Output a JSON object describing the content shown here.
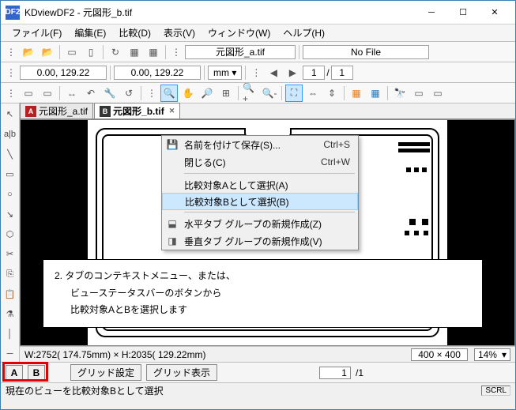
{
  "window": {
    "app_icon": "DF2",
    "title": "KDviewDF2 - 元図形_b.tif"
  },
  "menu": {
    "file": "ファイル(F)",
    "edit": "編集(E)",
    "compare": "比較(D)",
    "view": "表示(V)",
    "window": "ウィンドウ(W)",
    "help": "ヘルプ(H)"
  },
  "address": {
    "file_a": "元図形_a.tif",
    "file_b": "No File"
  },
  "coords": {
    "a": "0.00, 129.22",
    "b": "0.00, 129.22",
    "unit": "mm",
    "page_cur": "1",
    "page_tot": "1"
  },
  "tabs": {
    "a": "元図形_a.tif",
    "b": "元図形_b.tif"
  },
  "context_menu": {
    "save_as": "名前を付けて保存(S)...",
    "save_as_sc": "Ctrl+S",
    "close": "閉じる(C)",
    "close_sc": "Ctrl+W",
    "sel_a": "比較対象Aとして選択(A)",
    "sel_b": "比較対象Bとして選択(B)",
    "htab": "水平タブ グループの新規作成(Z)",
    "vtab": "垂直タブ グループの新規作成(V)"
  },
  "callout": {
    "num": "2. ",
    "l1": "タブのコンテキストメニュー、または、",
    "l2": "ビューステータスバーのボタンから",
    "l3": "比較対象AとBを選択します"
  },
  "viewstatus": {
    "dims": "W:2752( 174.75mm) × H:2035( 129.22mm)",
    "grid": "400 × 400",
    "zoom": "14%"
  },
  "abbar": {
    "a": "A",
    "b": "B",
    "grid_cfg": "グリッド設定",
    "grid_show": "グリッド表示",
    "pg_cur": "1",
    "pg_tot": "/1"
  },
  "status": {
    "msg": "現在のビューを比較対象Bとして選択",
    "scrl": "SCRL"
  }
}
